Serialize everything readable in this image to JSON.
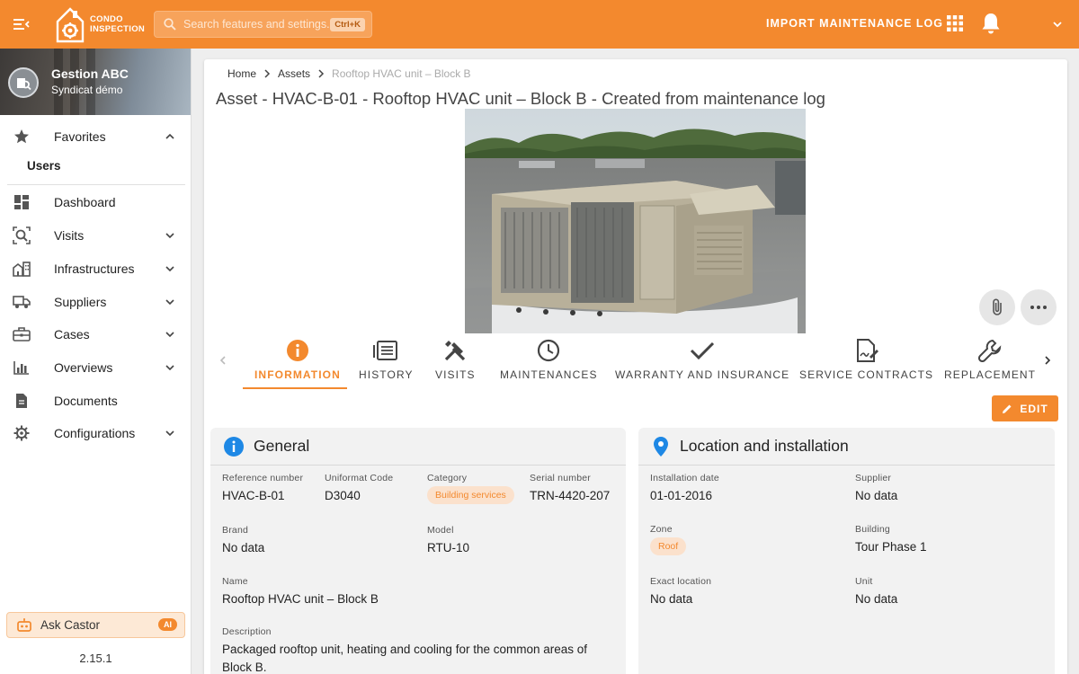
{
  "app": {
    "logo_line1": "CONDO",
    "logo_line2": "INSPECTION",
    "search_placeholder": "Search features and settings...",
    "search_shortcut": "Ctrl+K",
    "import_label": "IMPORT MAINTENANCE LOG",
    "brand_color": "#f3892e"
  },
  "sidebar": {
    "org_name": "Gestion ABC",
    "org_sub": "Syndicat démo",
    "favorites_label": "Favorites",
    "favorites_sub": "Users",
    "items": [
      {
        "label": "Dashboard",
        "icon": "dashboard-icon"
      },
      {
        "label": "Visits",
        "icon": "visits-icon"
      },
      {
        "label": "Infrastructures",
        "icon": "buildings-icon"
      },
      {
        "label": "Suppliers",
        "icon": "truck-icon"
      },
      {
        "label": "Cases",
        "icon": "briefcase-icon"
      },
      {
        "label": "Overviews",
        "icon": "bar-chart-icon"
      },
      {
        "label": "Documents",
        "icon": "document-icon"
      },
      {
        "label": "Configurations",
        "icon": "gear-icon"
      }
    ],
    "ask_label": "Ask Castor",
    "ai_badge": "AI",
    "version": "2.15.1"
  },
  "breadcrumb": {
    "home": "Home",
    "assets": "Assets",
    "current": "Rooftop HVAC unit – Block B"
  },
  "page_title": "Asset - HVAC-B-01 - Rooftop HVAC unit – Block B - Created from maintenance log",
  "tabs": [
    {
      "label": "INFORMATION",
      "icon": "info-icon"
    },
    {
      "label": "HISTORY",
      "icon": "history-list-icon"
    },
    {
      "label": "VISITS",
      "icon": "tools-icon"
    },
    {
      "label": "MAINTENANCES",
      "icon": "clock-icon"
    },
    {
      "label": "WARRANTY AND INSURANCE",
      "icon": "checkmark-icon"
    },
    {
      "label": "SERVICE CONTRACTS",
      "icon": "contract-icon"
    },
    {
      "label": "REPLACEMENT",
      "icon": "wrench-icon"
    }
  ],
  "edit_label": "EDIT",
  "general": {
    "title": "General",
    "reference_label": "Reference number",
    "reference": "HVAC-B-01",
    "uniformat_label": "Uniformat Code",
    "uniformat": "D3040",
    "category_label": "Category",
    "category": "Building services",
    "serial_label": "Serial number",
    "serial": "TRN-4420-207",
    "brand_label": "Brand",
    "brand": "No data",
    "model_label": "Model",
    "model": "RTU-10",
    "name_label": "Name",
    "name": "Rooftop HVAC unit – Block B",
    "description_label": "Description",
    "description": "Packaged rooftop unit, heating and cooling for the common areas of Block B."
  },
  "location": {
    "title": "Location and installation",
    "install_label": "Installation date",
    "install": "01-01-2016",
    "supplier_label": "Supplier",
    "supplier": "No data",
    "zone_label": "Zone",
    "zone": "Roof",
    "building_label": "Building",
    "building": "Tour Phase 1",
    "exact_label": "Exact location",
    "exact": "No data",
    "unit_label": "Unit",
    "unit": "No data"
  }
}
